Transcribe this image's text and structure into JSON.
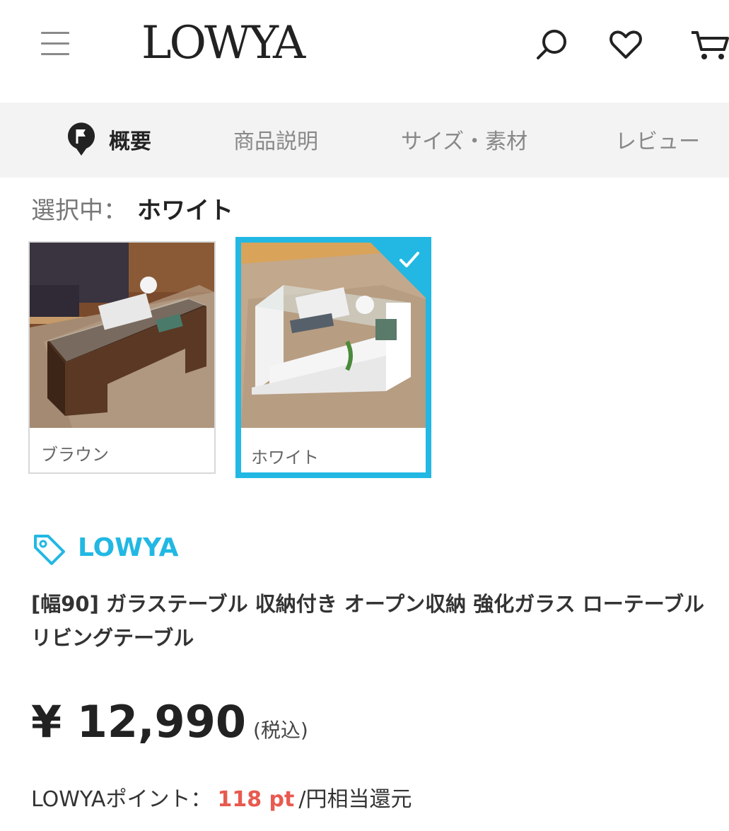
{
  "header": {
    "logo": "LOWYA",
    "icons": [
      "menu-icon",
      "search-icon",
      "heart-icon",
      "cart-icon"
    ]
  },
  "tabs": [
    {
      "label": "概要",
      "active": true
    },
    {
      "label": "商品説明",
      "active": false
    },
    {
      "label": "サイズ・素材",
      "active": false
    },
    {
      "label": "レビュー",
      "active": false
    }
  ],
  "selection": {
    "label": "選択中：",
    "value": "ホワイト"
  },
  "variants": [
    {
      "name": "ブラウン",
      "selected": false
    },
    {
      "name": "ホワイト",
      "selected": true
    }
  ],
  "brand": "LOWYA",
  "product_title": "[幅90] ガラステーブル 収納付き オープン収納 強化ガラス ローテーブル リビングテーブル",
  "price": {
    "amount": "¥ 12,990",
    "tax_note": "(税込)"
  },
  "points": {
    "label": "LOWYAポイント：",
    "value": "118 pt",
    "suffix": "/円相当還元"
  },
  "colors": {
    "accent": "#22b8e3",
    "points": "#e85a4f",
    "tabbar_bg": "#f3f3f3"
  }
}
